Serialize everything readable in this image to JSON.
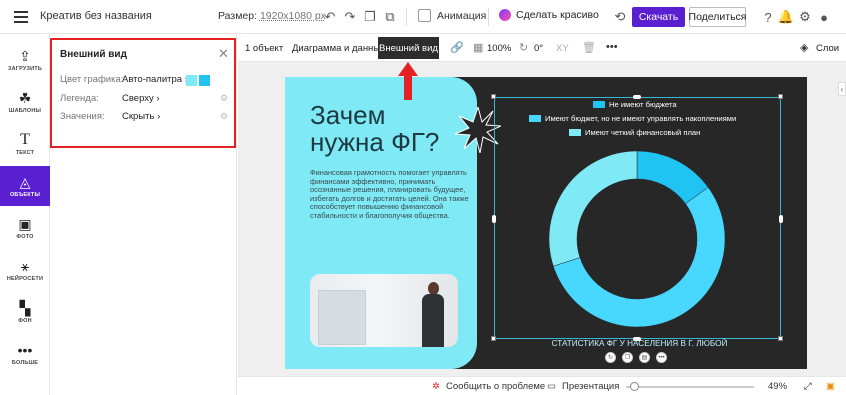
{
  "topbar": {
    "title": "Креатив без названия",
    "size_label": "Размер:",
    "size_value": "1920x1080 px",
    "animation_label": "Анимация",
    "magic_label": "Сделать красиво",
    "download_label": "Скачать",
    "share_label": "Поделиться"
  },
  "leftnav": {
    "items": [
      {
        "label": "ЗАГРУЗИТЬ",
        "icon": "upload-icon"
      },
      {
        "label": "ШАБЛОНЫ",
        "icon": "templates-icon"
      },
      {
        "label": "ТЕКСТ",
        "icon": "text-icon"
      },
      {
        "label": "ОБЪЕКТЫ",
        "icon": "objects-icon"
      },
      {
        "label": "ФОТО",
        "icon": "photo-icon"
      },
      {
        "label": "НЕЙРОСЕТИ",
        "icon": "magic-wand-icon"
      },
      {
        "label": "ФОН",
        "icon": "background-icon"
      },
      {
        "label": "БОЛЬШЕ",
        "icon": "more-icon"
      }
    ]
  },
  "panel": {
    "title": "Внешний вид",
    "rows": [
      {
        "label": "Цвет графика:",
        "value": "Авто-палитра"
      },
      {
        "label": "Легенда:",
        "value": "Сверху"
      },
      {
        "label": "Значения:",
        "value": "Скрыть"
      }
    ],
    "palette_colors": [
      "#7fe9f5",
      "#1fc4f2"
    ]
  },
  "ctxbar": {
    "count": "1 объект",
    "chart_data_tab": "Диаграмма и данные",
    "appearance_tab": "Внешний вид",
    "opacity": "100%",
    "rotation": "0°",
    "xy": "XY",
    "layers": "Слои"
  },
  "canvas": {
    "heading_line1": "Зачем",
    "heading_line2": "нужна ФГ?",
    "body": "Финансовая грамотность помогает управлять финансами эффективно, принимать осознанные решения, планировать будущее, избегать долгов и достигать целей. Она также способствует повышению финансовой стабильности и благополучия общества."
  },
  "chart_data": {
    "type": "pie",
    "categories": [
      "Не имеют бюджета",
      "Имеют бюджет, но не имеют управлять накоплениями",
      "Имеют четкий финансовый план"
    ],
    "values": [
      15,
      55,
      30
    ],
    "colors": [
      "#1fc4f2",
      "#48d8ff",
      "#7fe9f5"
    ],
    "title": "СТАТИСТИКА ФГ У НАСЕЛЕНИЯ В Г. ЛЮБОЙ",
    "legend": "top",
    "donut": true
  },
  "bottombar": {
    "report": "Сообщить о проблеме",
    "presentation": "Презентация",
    "zoom": "49%"
  }
}
